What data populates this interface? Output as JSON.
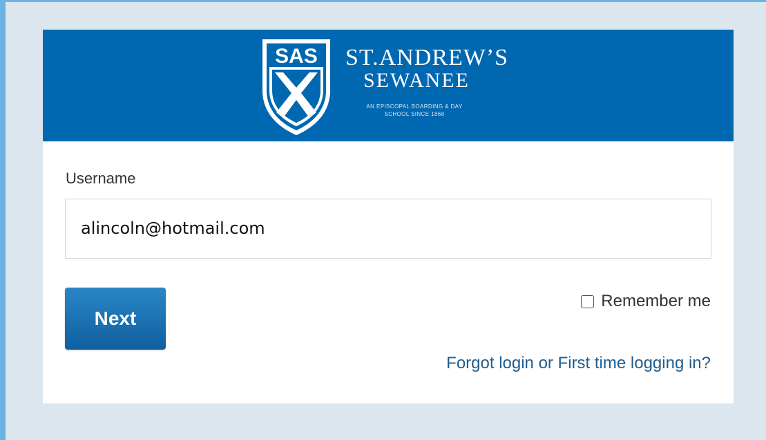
{
  "brand": {
    "shield_text": "SAS",
    "name_line1": "ST.ANDREW’S",
    "name_line2": "SEWANEE",
    "tagline_line1": "AN EPISCOPAL BOARDING & DAY",
    "tagline_line2": "SCHOOL SINCE 1868",
    "banner_color": "#0067b1"
  },
  "form": {
    "username_label": "Username",
    "username_value": "alincoln@hotmail.com",
    "next_label": "Next",
    "remember_label": "Remember me",
    "remember_checked": false,
    "forgot_link": "Forgot login or First time logging in?"
  }
}
